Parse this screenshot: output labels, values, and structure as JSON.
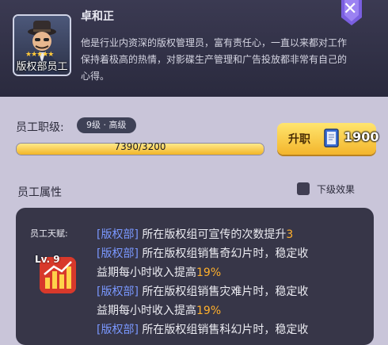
{
  "employee": {
    "avatar_caption": "版权部员工",
    "stars": "★★★★★",
    "name": "卓和正",
    "desc_line1": "他是行业内资深的版权管理员，富有责任心，一直以来都对工作",
    "desc_line2": "保持着极高的热情，对影碟生产管理和广告投放都非常有自己的",
    "desc_line3": "心得。"
  },
  "close_icon": "close-x-icon",
  "rank": {
    "label": "员工职级:",
    "value": "9级 · 高级",
    "progress_text": "7390/3200",
    "progress_fraction": 1.0
  },
  "promote": {
    "label": "升职",
    "cost": "1900",
    "icon": "book-icon"
  },
  "attributes": {
    "title": "员工属性",
    "checkbox_label": "下级效果"
  },
  "talent": {
    "label": "员工天赋:",
    "level": "Lv. 9",
    "lines": [
      {
        "tag": "[版权部]",
        "text": " 所在版权组可宣传的次数提升",
        "value": "3"
      },
      {
        "tag": "[版权部]",
        "text": " 所在版权组销售奇幻片时，稳定收",
        "value": ""
      },
      {
        "tag": "",
        "text": "益期每小时收入提高",
        "value": "19%"
      },
      {
        "tag": "[版权部]",
        "text": " 所在版权组销售灾难片时，稳定收",
        "value": ""
      },
      {
        "tag": "",
        "text": "益期每小时收入提高",
        "value": "19%"
      },
      {
        "tag": "[版权部]",
        "text": " 所在版权组销售科幻片时，稳定收",
        "value": ""
      }
    ]
  },
  "colors": {
    "tag_blue": "#7a98ff",
    "value_orange": "#ffb02c",
    "gold": "#f3b52c"
  }
}
